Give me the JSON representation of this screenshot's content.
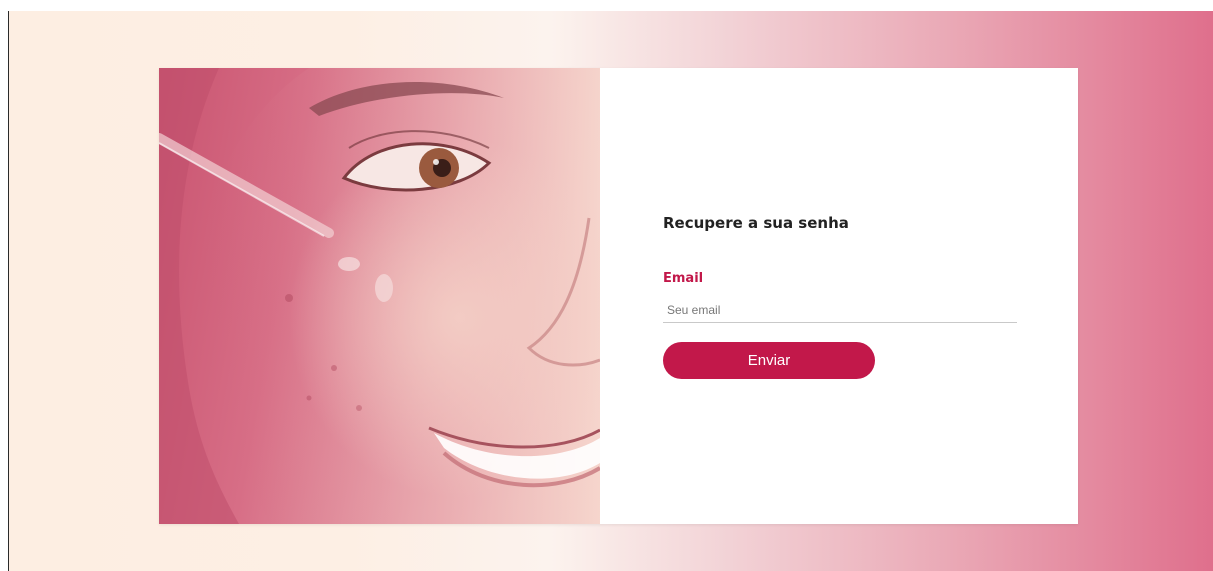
{
  "recover_form": {
    "title": "Recupere a sua senha",
    "email_label": "Email",
    "email_placeholder": "Seu email",
    "email_value": "",
    "submit_label": "Enviar"
  },
  "colors": {
    "accent": "#c2184a",
    "background_left": "#fdeee2",
    "background_right": "#df6f8c",
    "card": "#ffffff"
  }
}
